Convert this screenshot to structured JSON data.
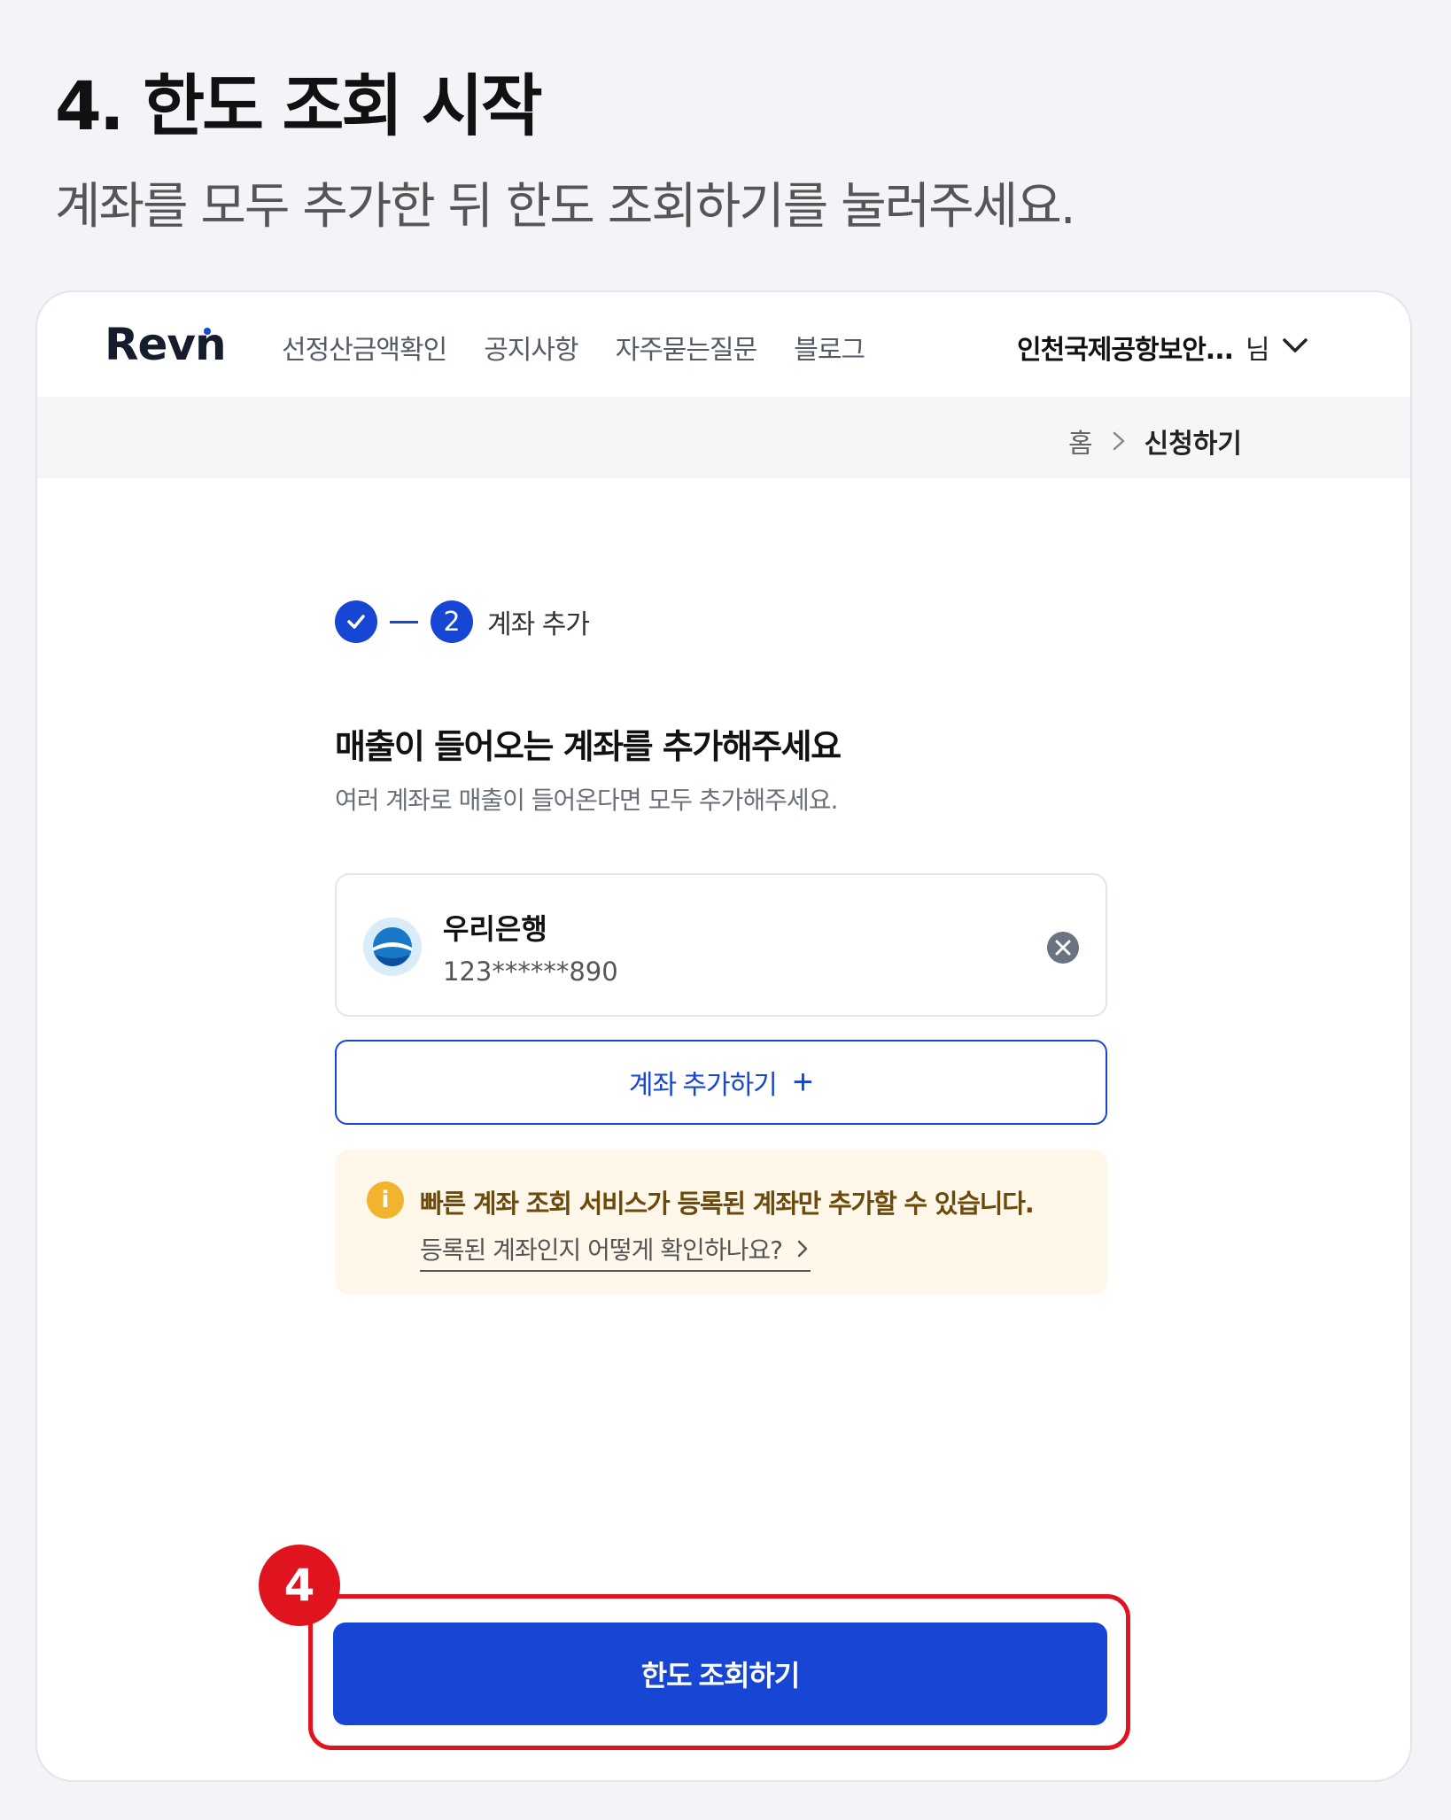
{
  "guide": {
    "title": "4. 한도 조회 시작",
    "subtitle": "계좌를 모두 추가한 뒤 한도 조회하기를 눌러주세요."
  },
  "header": {
    "logo": "Revn",
    "menu": [
      "선정산금액확인",
      "공지사항",
      "자주묻는질문",
      "블로그"
    ],
    "user_name": "인천국제공항보안...",
    "user_suffix": "님"
  },
  "breadcrumb": {
    "home": "홈",
    "current": "신청하기"
  },
  "stepper": {
    "current_number": "2",
    "current_label": "계좌 추가"
  },
  "section": {
    "title": "매출이 들어오는 계좌를 추가해주세요",
    "description": "여러 계좌로 매출이 들어온다면 모두 추가해주세요."
  },
  "account": {
    "bank_name": "우리은행",
    "account_number": "123******890"
  },
  "add_button": {
    "label": "계좌 추가하기",
    "icon": "plus-icon"
  },
  "notice": {
    "icon": "info-icon",
    "text": "빠른 계좌 조회 서비스가 등록된 계좌만 추가할 수 있습니다.",
    "link": "등록된 계좌인지 어떻게 확인하나요?"
  },
  "cta": {
    "label": "한도 조회하기"
  },
  "step_badge": "4",
  "colors": {
    "brand": "#1745d4",
    "highlight": "#e0141e",
    "notice_bg": "#fff8ea",
    "notice_icon": "#f2b32f"
  }
}
